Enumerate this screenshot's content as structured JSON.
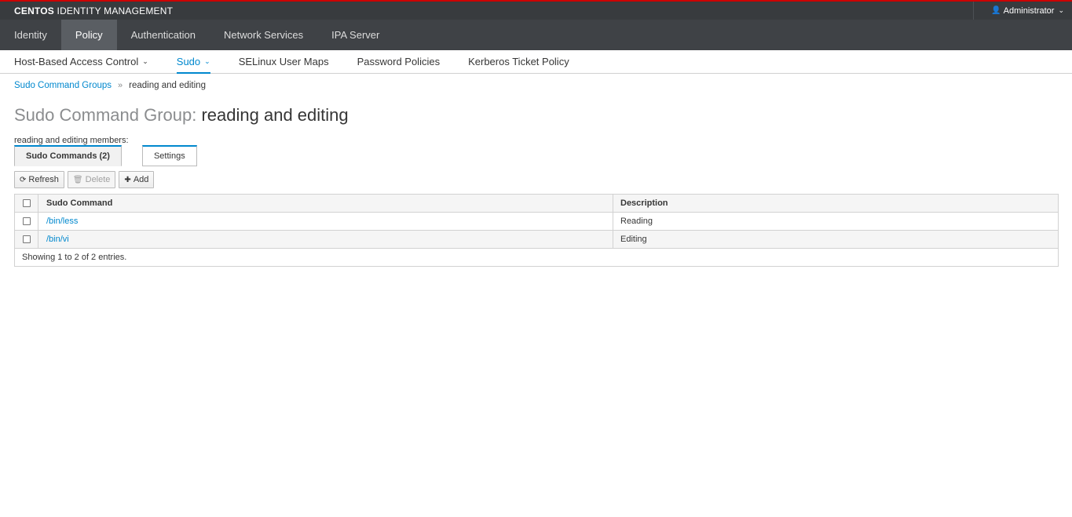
{
  "brand": {
    "bold": "CENTOS",
    "rest": " IDENTITY MANAGEMENT"
  },
  "user_menu": {
    "label": "Administrator",
    "icon": "user-icon"
  },
  "main_nav": [
    "Identity",
    "Policy",
    "Authentication",
    "Network Services",
    "IPA Server"
  ],
  "main_nav_active": "Policy",
  "sub_nav": [
    {
      "label": "Host-Based Access Control",
      "dropdown": true
    },
    {
      "label": "Sudo",
      "dropdown": true,
      "active": true
    },
    {
      "label": "SELinux User Maps"
    },
    {
      "label": "Password Policies"
    },
    {
      "label": "Kerberos Ticket Policy"
    }
  ],
  "breadcrumb": {
    "parent": "Sudo Command Groups",
    "separator": "»",
    "current": "reading and editing"
  },
  "title": {
    "prefix": "Sudo Command Group:",
    "name": "reading and editing"
  },
  "members_label": "reading and editing members:",
  "tabs": [
    {
      "label": "Sudo Commands (2)",
      "active": true
    },
    {
      "label": "Settings"
    }
  ],
  "toolbar": {
    "refresh": "Refresh",
    "delete": "Delete",
    "add": "Add"
  },
  "table": {
    "headers": [
      "Sudo Command",
      "Description"
    ],
    "rows": [
      {
        "command": "/bin/less",
        "description": "Reading"
      },
      {
        "command": "/bin/vi",
        "description": "Editing"
      }
    ],
    "footer": "Showing 1 to 2 of 2 entries."
  },
  "colors": {
    "accent": "#0088ce",
    "topbar": "#383b3e",
    "nav": "#3f4246",
    "nav_active": "#5a5e63",
    "brand_line": "#cc0000"
  }
}
